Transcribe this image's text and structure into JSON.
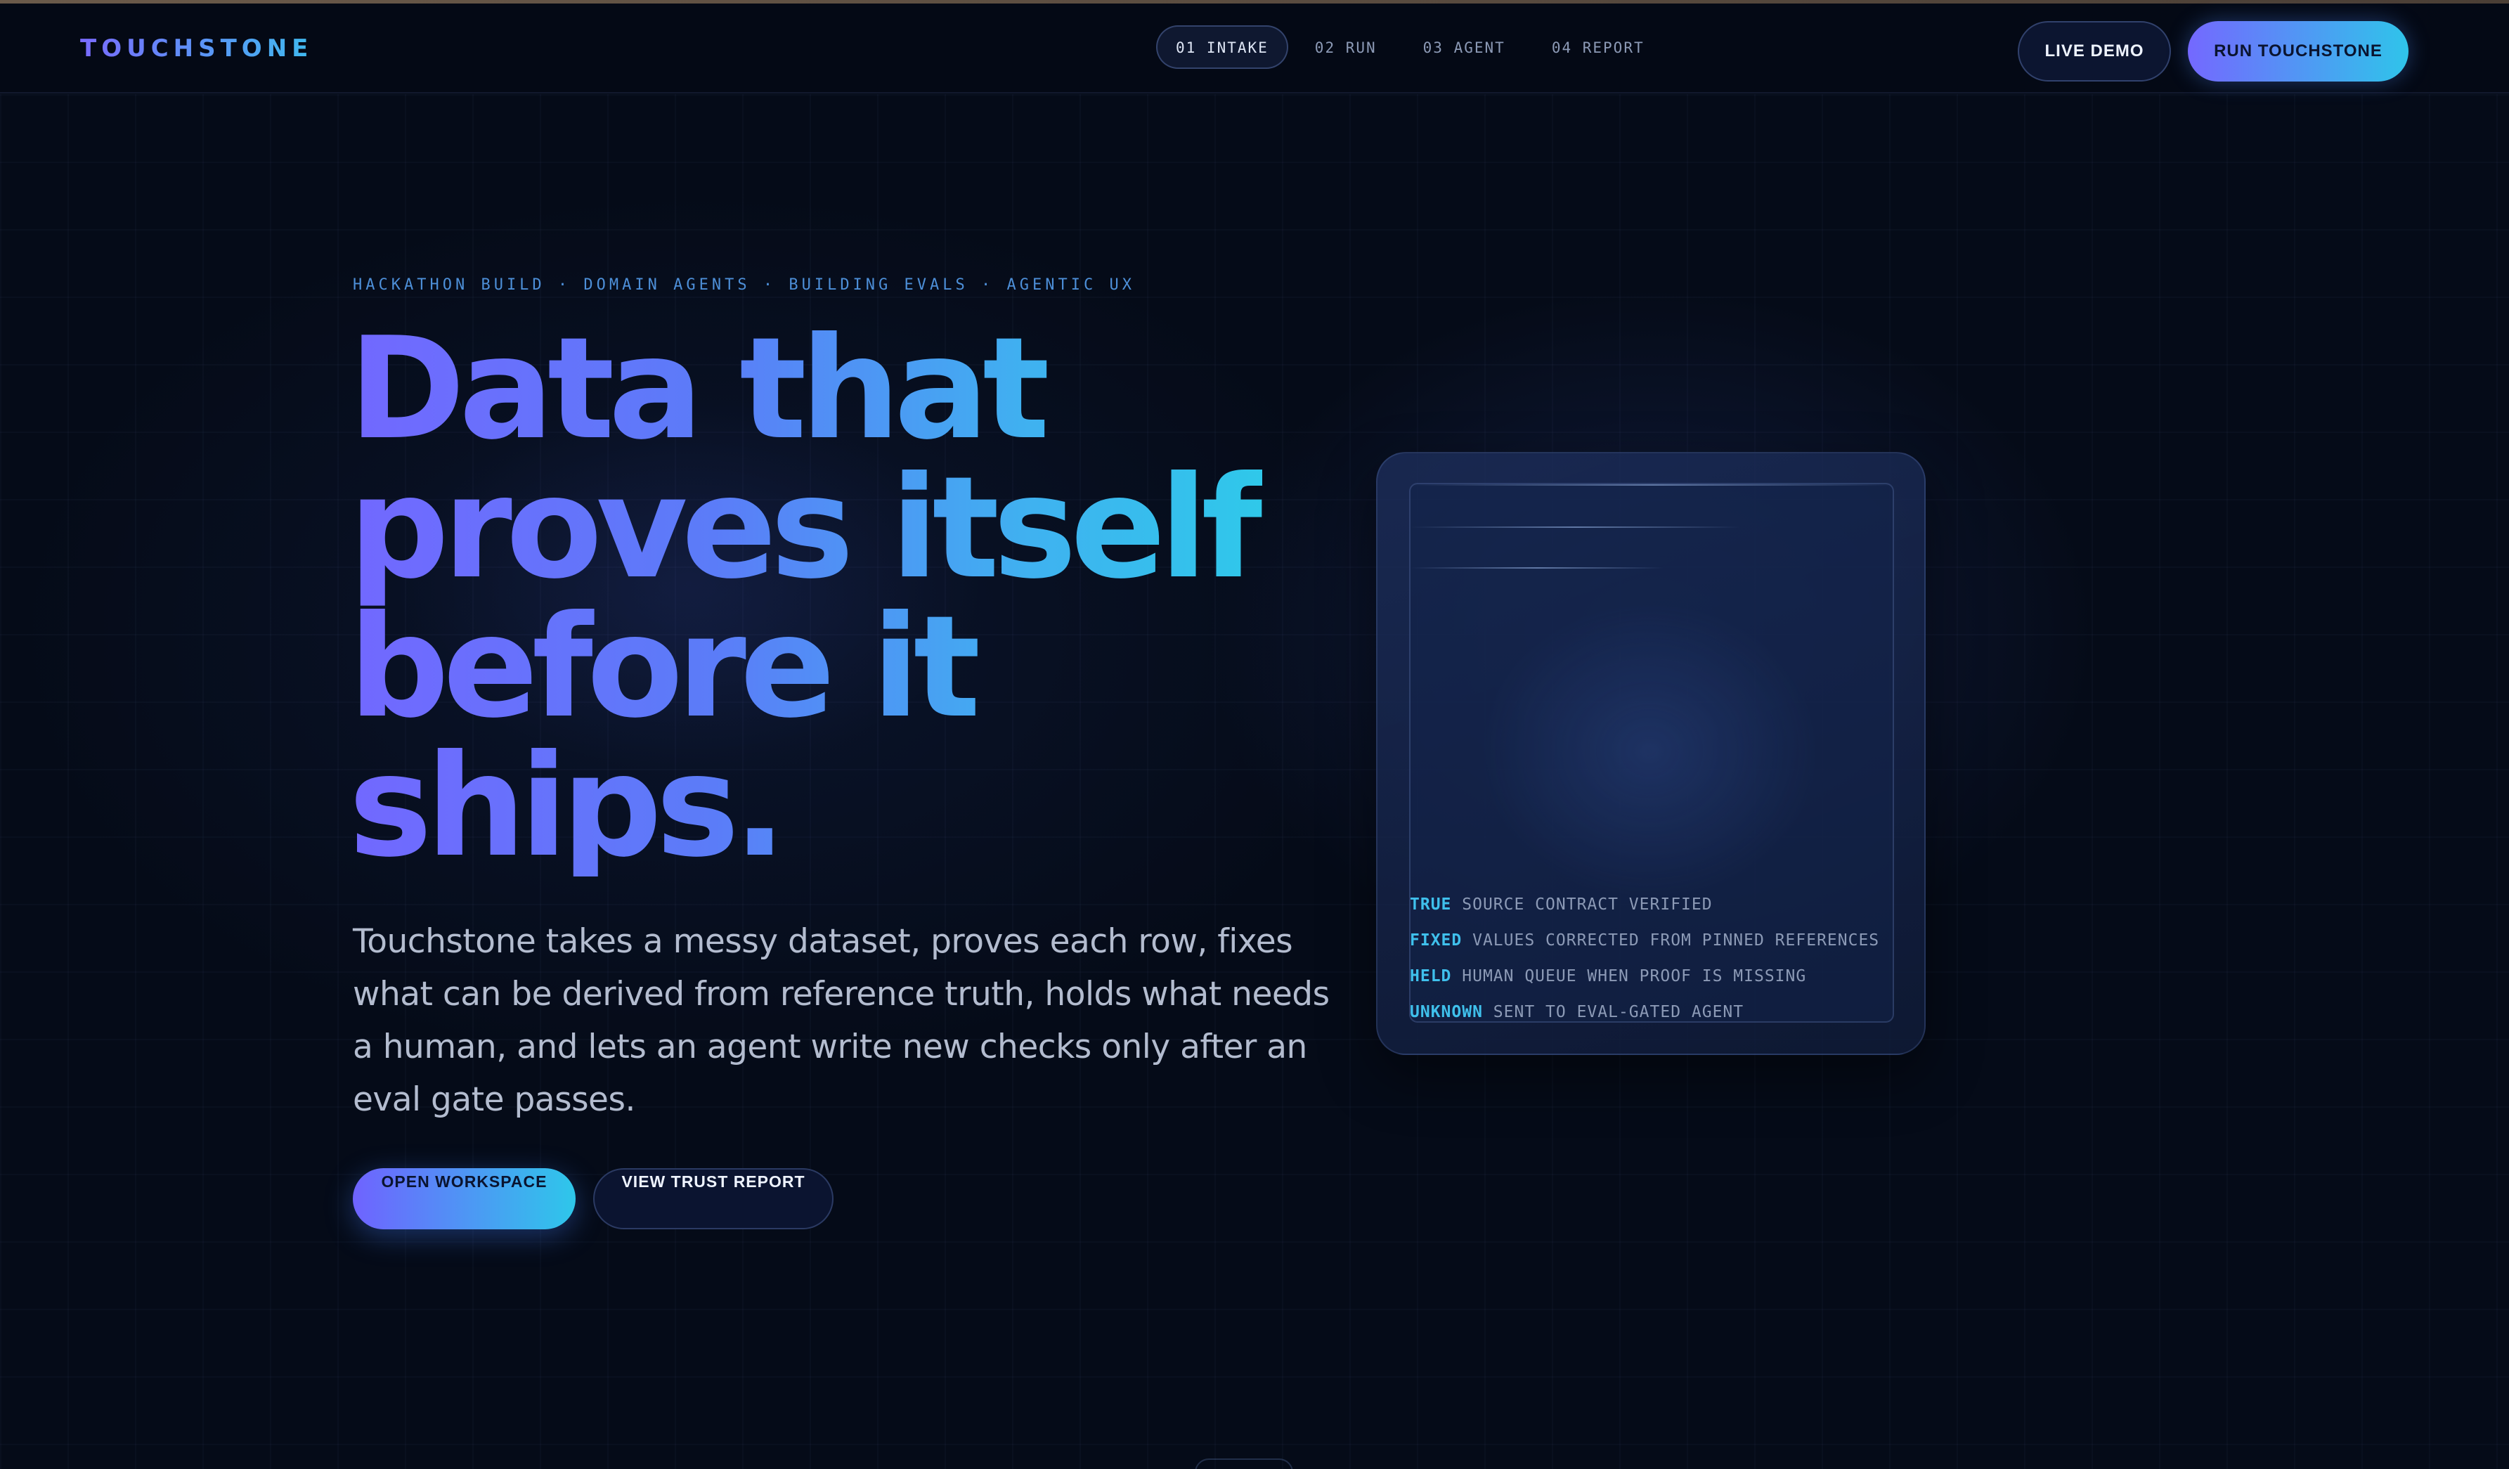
{
  "brand": {
    "name": "TOUCHSTONE"
  },
  "nav": {
    "steps": [
      {
        "label": "01 INTAKE",
        "active": true
      },
      {
        "label": "02 RUN",
        "active": false
      },
      {
        "label": "03 AGENT",
        "active": false
      },
      {
        "label": "04 REPORT",
        "active": false
      }
    ],
    "live_demo_label": "LIVE DEMO",
    "run_label": "RUN TOUCHSTONE"
  },
  "hero": {
    "eyebrow": "HACKATHON BUILD · DOMAIN AGENTS · BUILDING EVALS · AGENTIC UX",
    "headline": [
      "Data that",
      "proves itself",
      "before it",
      "ships."
    ],
    "lede": "Touchstone takes a messy dataset, proves each row, fixes what can be derived from reference truth, holds what needs a human, and lets an agent write new checks only after an eval gate passes.",
    "primary_cta": "OPEN WORKSPACE",
    "secondary_cta": "VIEW TRUST REPORT"
  },
  "card": {
    "legend": [
      {
        "tag": "TRUE",
        "text": "SOURCE CONTRACT VERIFIED"
      },
      {
        "tag": "FIXED",
        "text": "VALUES CORRECTED FROM PINNED REFERENCES"
      },
      {
        "tag": "HELD",
        "text": "HUMAN QUEUE WHEN PROOF IS MISSING"
      },
      {
        "tag": "UNKNOWN",
        "text": "SENT TO EVAL-GATED AGENT"
      }
    ]
  },
  "colors": {
    "background": "#050b18",
    "accent_start": "#7268ff",
    "accent_end": "#2fc8ea",
    "legend_tag": "#3fc0ec"
  }
}
